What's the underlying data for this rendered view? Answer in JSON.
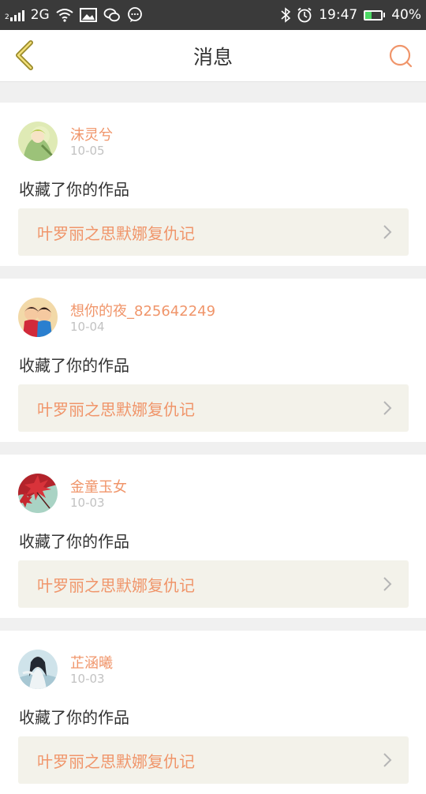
{
  "status_bar": {
    "network": "2G",
    "sim_number": "2",
    "time": "19:47",
    "battery": "40%",
    "battery_level": 0.4,
    "left_icons": [
      "sim-signal-icon",
      "wifi-icon",
      "image-notification-icon",
      "wechat-icon",
      "chat-bubble-icon"
    ],
    "right_icons": [
      "bluetooth-icon",
      "alarm-icon",
      "battery-icon"
    ]
  },
  "header": {
    "title": "消息",
    "back_icon": "chevron-left-icon",
    "search_icon": "search-icon",
    "accent_color": "#f0956a",
    "back_color": "#9a8a2a"
  },
  "messages": [
    {
      "username": "沫灵兮",
      "date": "10-05",
      "action": "收藏了你的作品",
      "work_title": "叶罗丽之思默娜复仇记",
      "avatar": "anime-girl-avatar"
    },
    {
      "username": "想你的夜_825642249",
      "date": "10-04",
      "action": "收藏了你的作品",
      "work_title": "叶罗丽之思默娜复仇记",
      "avatar": "kids-kiss-avatar"
    },
    {
      "username": "金童玉女",
      "date": "10-03",
      "action": "收藏了你的作品",
      "work_title": "叶罗丽之思默娜复仇记",
      "avatar": "red-maple-avatar"
    },
    {
      "username": "芷涵曦",
      "date": "10-03",
      "action": "收藏了你的作品",
      "work_title": "叶罗丽之思默娜复仇记",
      "avatar": "fairy-avatar"
    }
  ]
}
